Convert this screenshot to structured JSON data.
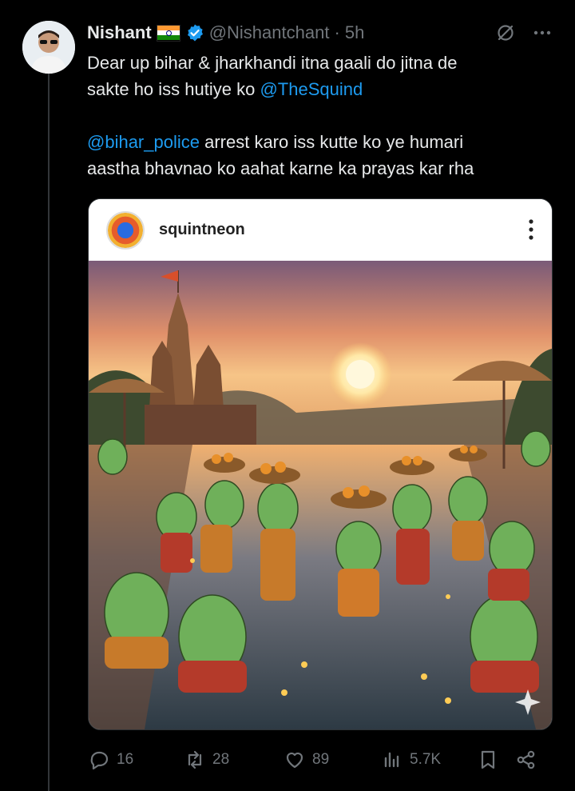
{
  "tweet": {
    "author_name": "Nishant",
    "handle": "@Nishantchant",
    "time": "· 5h",
    "line1_text": "Dear up bihar & jharkhandi itna gaali do jitna de",
    "line2_text": "sakte ho iss hutiye ko ",
    "mention1": "@TheSquind",
    "mention2": "@bihar_police",
    "line3_text": " arrest karo iss kutte ko ye humari",
    "line4_text": "aastha bhavnao ko aahat karne ka prayas kar rha"
  },
  "embedded_post": {
    "username": "squintneon"
  },
  "actions": {
    "replies": "16",
    "retweets": "28",
    "likes": "89",
    "views": "5.7K"
  },
  "colors": {
    "background": "#000000",
    "text": "#e7e9ea",
    "muted": "#71767b",
    "link": "#1d9bf0",
    "verified": "#1d9bf0"
  },
  "icons": [
    "flag-india-icon",
    "verified-badge-icon",
    "grok-icon",
    "more-icon",
    "reply-icon",
    "retweet-icon",
    "like-icon",
    "views-icon",
    "bookmark-icon",
    "share-icon"
  ]
}
